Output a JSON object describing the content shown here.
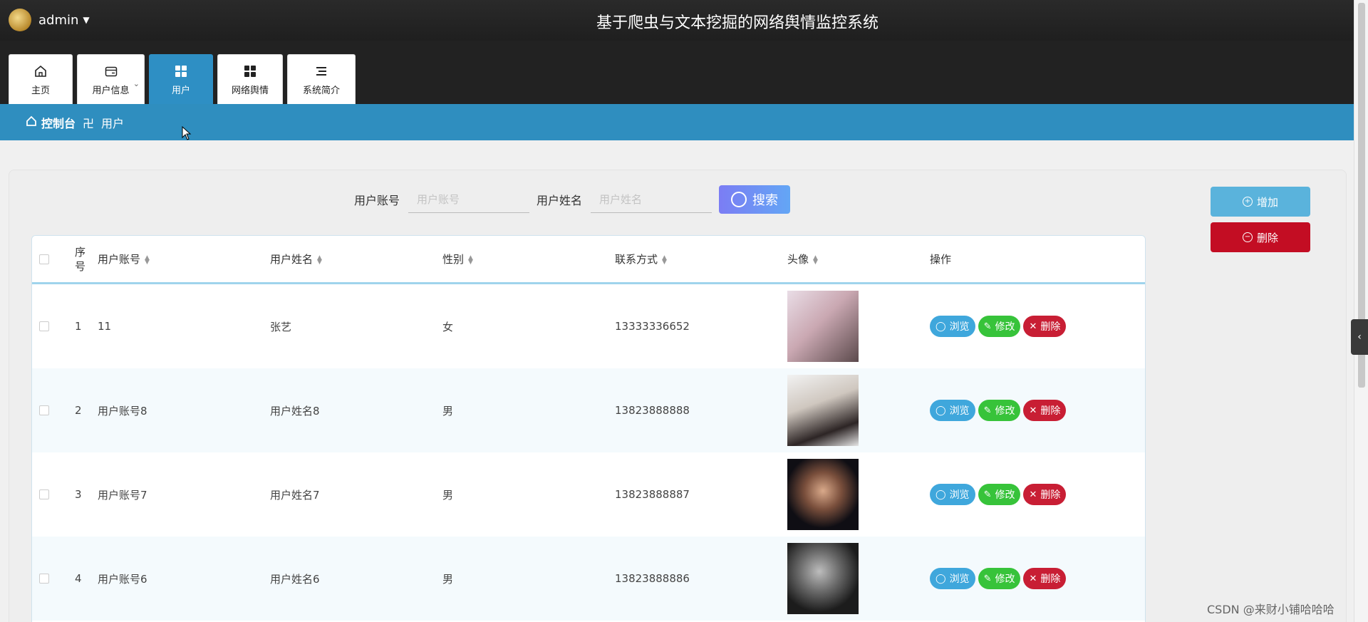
{
  "header": {
    "username": "admin",
    "app_title": "基于爬虫与文本挖掘的网络舆情监控系统"
  },
  "nav": {
    "tabs": [
      {
        "label": "主页",
        "icon": "home-icon"
      },
      {
        "label": "用户信息",
        "icon": "wallet-icon"
      },
      {
        "label": "用户",
        "icon": "grid-icon",
        "active": true
      },
      {
        "label": "网络舆情",
        "icon": "grid-icon"
      },
      {
        "label": "系统简介",
        "icon": "list-icon"
      }
    ]
  },
  "breadcrumb": {
    "home": "控制台",
    "separator": "卍",
    "current": "用户"
  },
  "search": {
    "account_label": "用户账号",
    "account_placeholder": "用户账号",
    "name_label": "用户姓名",
    "name_placeholder": "用户姓名",
    "button": "搜索"
  },
  "actions": {
    "add": "增加",
    "delete": "删除"
  },
  "table": {
    "headers": {
      "index": "序号",
      "account": "用户账号",
      "name": "用户姓名",
      "sex": "性别",
      "phone": "联系方式",
      "avatar": "头像",
      "ops": "操作"
    },
    "rows": [
      {
        "index": "1",
        "account": "11",
        "name": "张艺",
        "sex": "女",
        "phone": "13333336652"
      },
      {
        "index": "2",
        "account": "用户账号8",
        "name": "用户姓名8",
        "sex": "男",
        "phone": "13823888888"
      },
      {
        "index": "3",
        "account": "用户账号7",
        "name": "用户姓名7",
        "sex": "男",
        "phone": "13823888887"
      },
      {
        "index": "4",
        "account": "用户账号6",
        "name": "用户姓名6",
        "sex": "男",
        "phone": "13823888886"
      }
    ],
    "row_ops": {
      "view": "浏览",
      "edit": "修改",
      "delete": "删除"
    }
  },
  "watermark": "CSDN @来财小铺哈哈哈",
  "colors": {
    "nav_active": "#2e8fc4",
    "breadcrumb_bg": "#2f8ebf",
    "add_button": "#5ab3dc",
    "delete_button": "#c30d23",
    "view_button": "#3fa7dc",
    "edit_button": "#37c33a"
  }
}
